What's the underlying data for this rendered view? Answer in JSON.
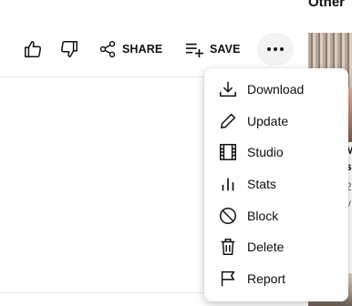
{
  "header": {
    "clipped_label": "Other"
  },
  "actions": {
    "like": {
      "icon": "thumbs-up-icon"
    },
    "dislike": {
      "icon": "thumbs-down-icon"
    },
    "share": {
      "label": "SHARE",
      "icon": "share-icon"
    },
    "save": {
      "label": "SAVE",
      "icon": "playlist-add-icon"
    },
    "more": {
      "icon": "more-horizontal-icon"
    }
  },
  "menu": {
    "items": [
      {
        "label": "Download",
        "icon": "download-icon"
      },
      {
        "label": "Update",
        "icon": "pencil-icon"
      },
      {
        "label": "Studio",
        "icon": "film-icon"
      },
      {
        "label": "Stats",
        "icon": "bar-chart-icon"
      },
      {
        "label": "Block",
        "icon": "block-icon"
      },
      {
        "label": "Delete",
        "icon": "trash-icon"
      },
      {
        "label": "Report",
        "icon": "flag-icon"
      }
    ]
  },
  "sidebar_clipped": {
    "line1": "M",
    "line2": "s",
    "line3": "2",
    "line4": "v"
  },
  "colors": {
    "text": "#0f0f0f",
    "more_button_bg": "#f2f2f2",
    "divider": "#e5e5e5"
  }
}
